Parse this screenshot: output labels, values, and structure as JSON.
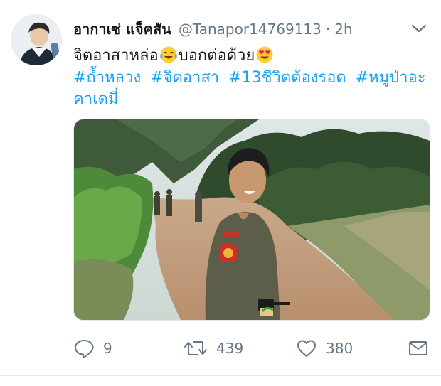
{
  "user": {
    "display_name": "อากาเซ่ แจ็คสัน",
    "handle": "@Tanapor14769113",
    "time": "2h"
  },
  "tweet": {
    "text_part1": "จิตอาสาหล่อ",
    "text_part2": "บอกต่อด้วย",
    "emoji1": "tears-of-joy-emoji",
    "emoji2": "heart-eyes-emoji",
    "hashtags": [
      "#ถ้ำหลวง",
      "#จิตอาสา",
      "#13ชีวิตต้องรอด",
      "#หมูป่าอะคาเดมี่"
    ]
  },
  "actions": {
    "reply_count": "9",
    "retweet_count": "439",
    "like_count": "380"
  },
  "colors": {
    "accent": "#1da1f2",
    "secondary_text": "#657786",
    "primary_text": "#14171a"
  }
}
